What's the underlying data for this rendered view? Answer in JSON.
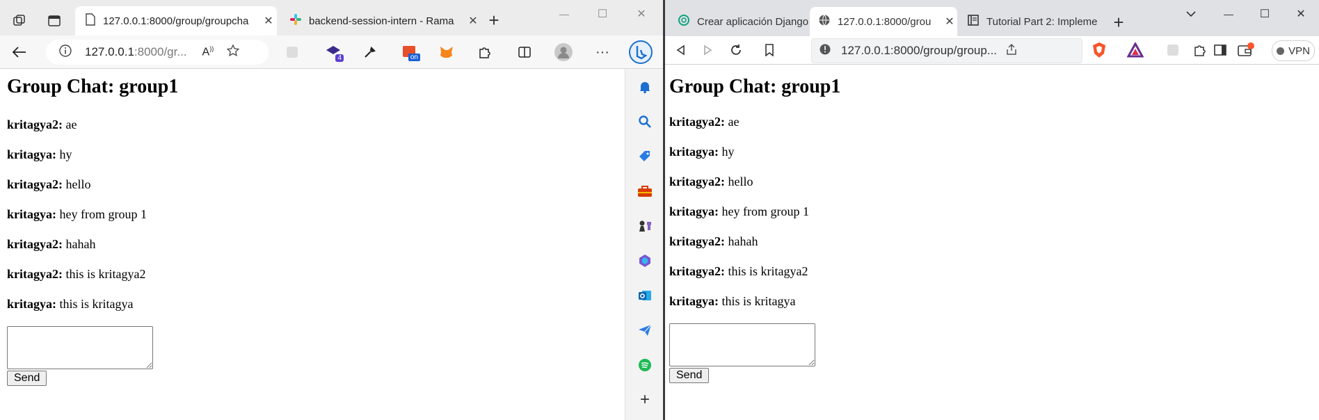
{
  "edge": {
    "tabs": [
      {
        "label": "127.0.0.1:8000/group/groupcha",
        "close": "✕"
      },
      {
        "label": "backend-session-intern - Rama",
        "close": "✕"
      }
    ],
    "new_tab": "+",
    "window_controls": {
      "minimize": "—",
      "maximize": "☐",
      "close": "✕"
    },
    "url": {
      "host": "127.0.0.1",
      "rest": ":8000/gr..."
    },
    "ext_badges": {
      "badge4": "4",
      "badge_on": "on"
    },
    "more": "···",
    "sidebar_add": "+"
  },
  "brave": {
    "tabs": [
      {
        "label": "Crear aplicación Django",
        "close": "✕"
      },
      {
        "label": "127.0.0.1:8000/grou",
        "close": "✕"
      },
      {
        "label": "Tutorial Part 2: Impleme",
        "close": "✕"
      }
    ],
    "new_tab": "+",
    "window_controls": {
      "minimize": "—",
      "maximize": "☐",
      "close": "✕"
    },
    "url": "127.0.0.1:8000/group/group...",
    "vpn": "VPN"
  },
  "chat": {
    "title": "Group Chat: group1",
    "messages": [
      {
        "user": "kritagya2:",
        "text": "ae"
      },
      {
        "user": "kritagya:",
        "text": "hy"
      },
      {
        "user": "kritagya2:",
        "text": "hello"
      },
      {
        "user": "kritagya:",
        "text": "hey from group 1"
      },
      {
        "user": "kritagya2:",
        "text": "hahah"
      },
      {
        "user": "kritagya2:",
        "text": "this is kritagya2"
      },
      {
        "user": "kritagya:",
        "text": "this is kritagya"
      }
    ],
    "input_value": "",
    "send_label": "Send"
  },
  "colors": {
    "edge_bing": "#1b6fd1",
    "brave_orange": "#fb542b",
    "slack_magenta": "#e01e5a",
    "spotify_green": "#1db954",
    "outlook_blue": "#0a64ad"
  }
}
